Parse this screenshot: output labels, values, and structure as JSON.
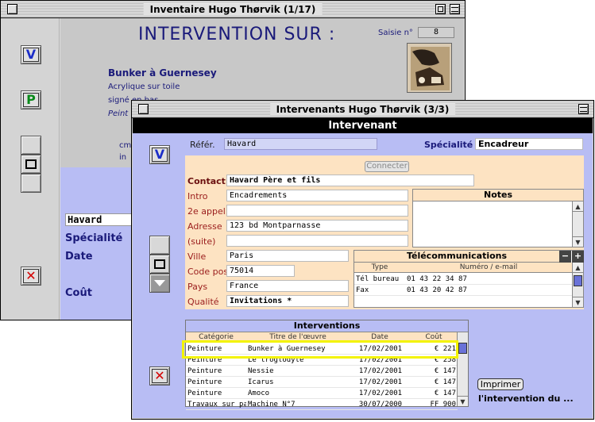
{
  "window_back": {
    "title": "Inventaire Hugo Thørvik (1/17)",
    "heading": "INTERVENTION SUR :",
    "saisie_label": "Saisie n°",
    "saisie_value": "8",
    "work_title": "Bunker à Guernesey",
    "medium": "Acrylique sur toile",
    "signature": "signé en bas",
    "painter_partial": "Peint",
    "dim_partial": "cm",
    "in_partial": "in",
    "buttons": {
      "v": "V",
      "p": "P",
      "x": "✕"
    },
    "field_name": "Havard",
    "labels": {
      "specialite": "Spécialité",
      "date": "Date",
      "cout": "Coût"
    }
  },
  "window_front": {
    "title": "Intervenants Hugo Thørvik (3/3)",
    "header": "Intervenant",
    "buttons": {
      "v": "V",
      "x": "✕"
    },
    "refer_label": "Référ.",
    "refer_value": "Havard",
    "specialite_label": "Spécialité",
    "specialite_value": "Encadreur",
    "connect_label": "Connecter",
    "form": {
      "contact_label": "Contact",
      "contact_value": "Havard Père et fils",
      "intro_label": "Intro",
      "intro_value": "Encadrements",
      "appel_label": "2e appel.",
      "appel_value": "",
      "adresse_label": "Adresse",
      "adresse_value": "123 bd Montparnasse",
      "suite_label": "(suite)",
      "suite_value": "",
      "ville_label": "Ville",
      "ville_value": "Paris",
      "cp_label": "Code post.",
      "cp_value": "75014",
      "pays_label": "Pays",
      "pays_value": "France",
      "qualite_label": "Qualité",
      "qualite_value": "Invitations *"
    },
    "notes_title": "Notes",
    "telecom": {
      "title": "Télécommunications",
      "col_type": "Type",
      "col_num": "Numéro / e-mail",
      "rows": [
        {
          "type": "Tél bureau",
          "num": "01 43 22 34 87"
        },
        {
          "type": "Fax",
          "num": "01 43 20 42 87"
        }
      ],
      "minus": "−",
      "plus": "+"
    },
    "interventions": {
      "title": "Interventions",
      "cols": [
        "Catégorie",
        "Titre de l'œuvre",
        "Date",
        "Coût"
      ],
      "rows": [
        {
          "cat": "Peinture",
          "titre": "Bunker à Guernesey",
          "date": "17/02/2001",
          "cout": "€ 221"
        },
        {
          "cat": "Peinture",
          "titre": "Le troglodyte",
          "date": "17/02/2001",
          "cout": "€ 258"
        },
        {
          "cat": "Peinture",
          "titre": "Nessie",
          "date": "17/02/2001",
          "cout": "€ 147"
        },
        {
          "cat": "Peinture",
          "titre": "Icarus",
          "date": "17/02/2001",
          "cout": "€ 147"
        },
        {
          "cat": "Peinture",
          "titre": "Amoco",
          "date": "17/02/2001",
          "cout": "€ 147"
        },
        {
          "cat": "Travaux sur pa",
          "titre": "Machine N°7",
          "date": "30/07/2000",
          "cout": "FF 900"
        }
      ]
    },
    "print_label": "Imprimer",
    "print_caption": "l'intervention du ..."
  }
}
